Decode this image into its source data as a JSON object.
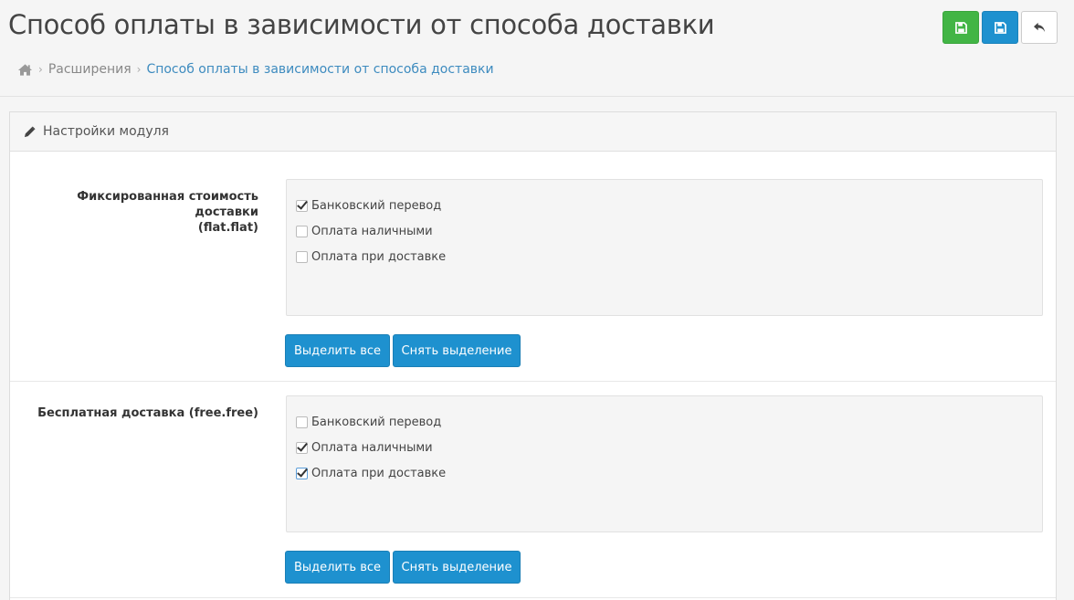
{
  "header": {
    "title": "Способ оплаты в зависимости от способа доставки",
    "breadcrumb": {
      "home_icon": "home-icon",
      "items": [
        {
          "label": "Расширения"
        },
        {
          "label": "Способ оплаты в зависимости от способа доставки"
        }
      ]
    },
    "toolbar": {
      "buttons": [
        {
          "icon": "save-icon",
          "color": "#42b545"
        },
        {
          "icon": "save-icon",
          "color": "#1e91cf"
        },
        {
          "icon": "reply-icon",
          "color": "#ffffff"
        }
      ]
    }
  },
  "panel": {
    "icon": "pencil-icon",
    "title": "Настройки модуля",
    "rows": [
      {
        "label_line1": "Фиксированная стоимость доставки",
        "label_line2": "(flat.flat)",
        "options": [
          {
            "label": "Банковский перевод",
            "checked": true
          },
          {
            "label": "Оплата наличными",
            "checked": false
          },
          {
            "label": "Оплата при доставке",
            "checked": false
          }
        ],
        "select_all": "Выделить все",
        "deselect": "Снять выделение"
      },
      {
        "label_line1": "Бесплатная доставка (free.free)",
        "options": [
          {
            "label": "Банковский перевод",
            "checked": false
          },
          {
            "label": "Оплата наличными",
            "checked": true
          },
          {
            "label": "Оплата при доставке",
            "checked": true
          }
        ],
        "select_all": "Выделить все",
        "deselect": "Снять выделение"
      }
    ]
  },
  "colors": {
    "primary": "#1e91cf",
    "success": "#42b545",
    "link": "#3d8bbf"
  }
}
